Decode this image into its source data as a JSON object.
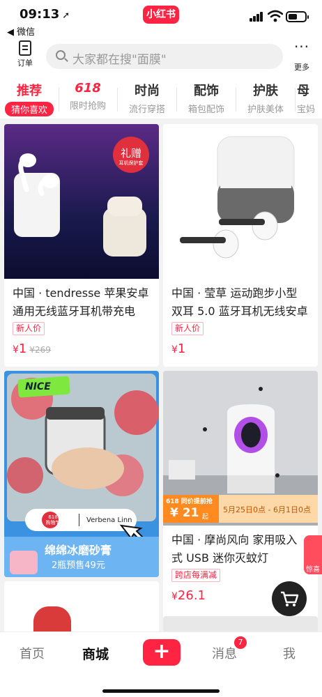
{
  "status": {
    "time": "09:13",
    "back_app": "◀ 微信",
    "app_logo": "小红书"
  },
  "header": {
    "orders_label": "订单",
    "search_placeholder": "大家都在搜\"面膜\"",
    "more_label": "更多"
  },
  "tabs": [
    {
      "title": "推荐",
      "sub": "猜你喜欢"
    },
    {
      "title": "618",
      "sub": "限时抢购"
    },
    {
      "title": "时尚",
      "sub": "流行穿搭"
    },
    {
      "title": "配饰",
      "sub": "箱包配饰"
    },
    {
      "title": "护肤",
      "sub": "护肤美体"
    },
    {
      "title": "母",
      "sub": "宝妈"
    }
  ],
  "products": [
    {
      "badge": "礼赠",
      "badge_sub": "耳机保护套",
      "title_line1": "中国 · tendresse 苹果安卓",
      "title_line2": "通用无线蓝牙耳机带充电",
      "tag": "新人价",
      "price": "1",
      "orig_price": "¥269"
    },
    {
      "title_line1": "中国 · 莹草 运动跑步小型",
      "title_line2": "双耳 5.0 蓝牙耳机无线安卓",
      "tag": "新人价",
      "price": "1"
    },
    {
      "nice": "NICE",
      "promo_pill": "618",
      "promo_pill_sub": "购物节",
      "brand": "Verbena Linn",
      "product_name": "绵绵冰磨砂膏",
      "product_deal": "2瓶预售49元"
    },
    {
      "banner_618": "618 同价提前抢",
      "banner_price": "¥ 21",
      "banner_unit": "起",
      "banner_dates": "5月25日0点 - 6月1日0点",
      "title_line1": "中国 · 摩尚风向 家用吸入",
      "title_line2": "式 USB 迷你灭蚊灯",
      "tag": "跨店每满减",
      "price": "26.1"
    }
  ],
  "side_promo": "惊喜抽",
  "nav": {
    "home": "首页",
    "mall": "商城",
    "plus": "+",
    "messages": "消息",
    "messages_badge": "7",
    "me": "我"
  },
  "colors": {
    "accent": "#ff2442"
  },
  "icons": [
    "location-arrow-icon",
    "signal-icon",
    "wifi-icon",
    "battery-icon",
    "orders-icon",
    "search-icon",
    "more-dots-icon",
    "cart-icon",
    "plus-icon"
  ]
}
